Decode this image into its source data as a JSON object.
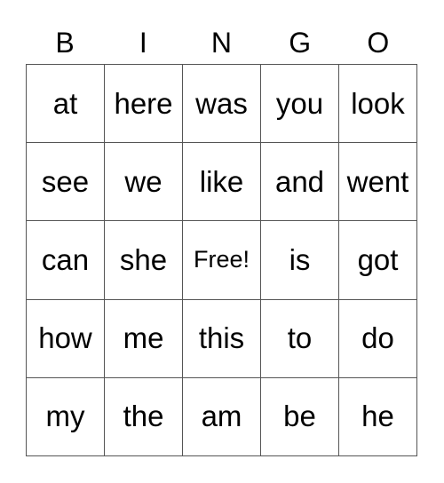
{
  "header": [
    "B",
    "I",
    "N",
    "G",
    "O"
  ],
  "rows": [
    [
      "at",
      "here",
      "was",
      "you",
      "look"
    ],
    [
      "see",
      "we",
      "like",
      "and",
      "went"
    ],
    [
      "can",
      "she",
      "Free!",
      "is",
      "got"
    ],
    [
      "how",
      "me",
      "this",
      "to",
      "do"
    ],
    [
      "my",
      "the",
      "am",
      "be",
      "he"
    ]
  ]
}
